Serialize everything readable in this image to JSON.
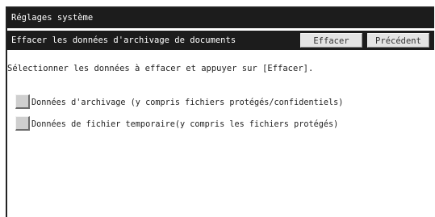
{
  "header": {
    "title": "Réglages système"
  },
  "subheader": {
    "title": "Effacer les données d'archivage de documents",
    "effacer_label": "Effacer",
    "precedent_label": "Précédent"
  },
  "main": {
    "instruction": "Sélectionner les données à effacer et appuyer sur [Effacer].",
    "options": [
      {
        "label": "Données d'archivage (y compris fichiers protégés/confidentiels)",
        "checked": false
      },
      {
        "label": "Données de fichier temporaire(y compris les fichiers protégés)",
        "checked": false
      }
    ]
  },
  "colors": {
    "bar_background": "#1c1c1c",
    "bar_text": "#ffffff",
    "button_face": "#e4e4e4",
    "checkbox_face": "#cfcfcf"
  }
}
